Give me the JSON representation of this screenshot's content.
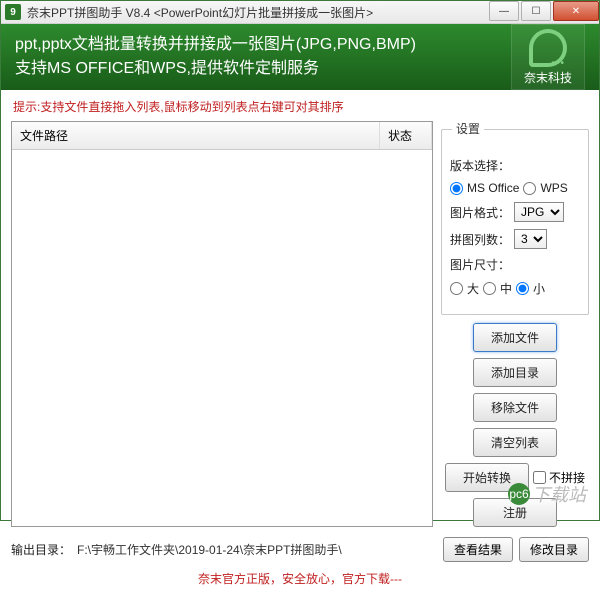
{
  "titlebar": {
    "title": "奈末PPT拼图助手 V8.4 <PowerPoint幻灯片批量拼接成一张图片>"
  },
  "banner": {
    "line1": "ppt,pptx文档批量转换并拼接成一张图片(JPG,PNG,BMP)",
    "line2": "支持MS OFFICE和WPS,提供软件定制服务",
    "logo_label": "奈末科技"
  },
  "hint": "提示:支持文件直接拖入列表,鼠标移动到列表点右键可对其排序",
  "list": {
    "col_path": "文件路径",
    "col_status": "状态"
  },
  "settings": {
    "title": "设置",
    "version_label": "版本选择：",
    "version_ms": "MS Office",
    "version_wps": "WPS",
    "format_label": "图片格式：",
    "format_value": "JPG",
    "cols_label": "拼图列数：",
    "cols_value": "3",
    "size_label": "图片尺寸：",
    "size_large": "大",
    "size_medium": "中",
    "size_small": "小"
  },
  "buttons": {
    "add_file": "添加文件",
    "add_dir": "添加目录",
    "remove": "移除文件",
    "clear": "清空列表",
    "start": "开始转换",
    "no_merge": "不拼接",
    "register": "注册"
  },
  "output": {
    "label": "输出目录：",
    "path": "F:\\宇畅工作文件夹\\2019-01-24\\奈末PPT拼图助手\\",
    "view": "查看结果",
    "modify": "修改目录"
  },
  "footer": {
    "text1": "奈末官方正版，安全放心，官方下载---",
    "link": ""
  },
  "watermark": "下载站"
}
